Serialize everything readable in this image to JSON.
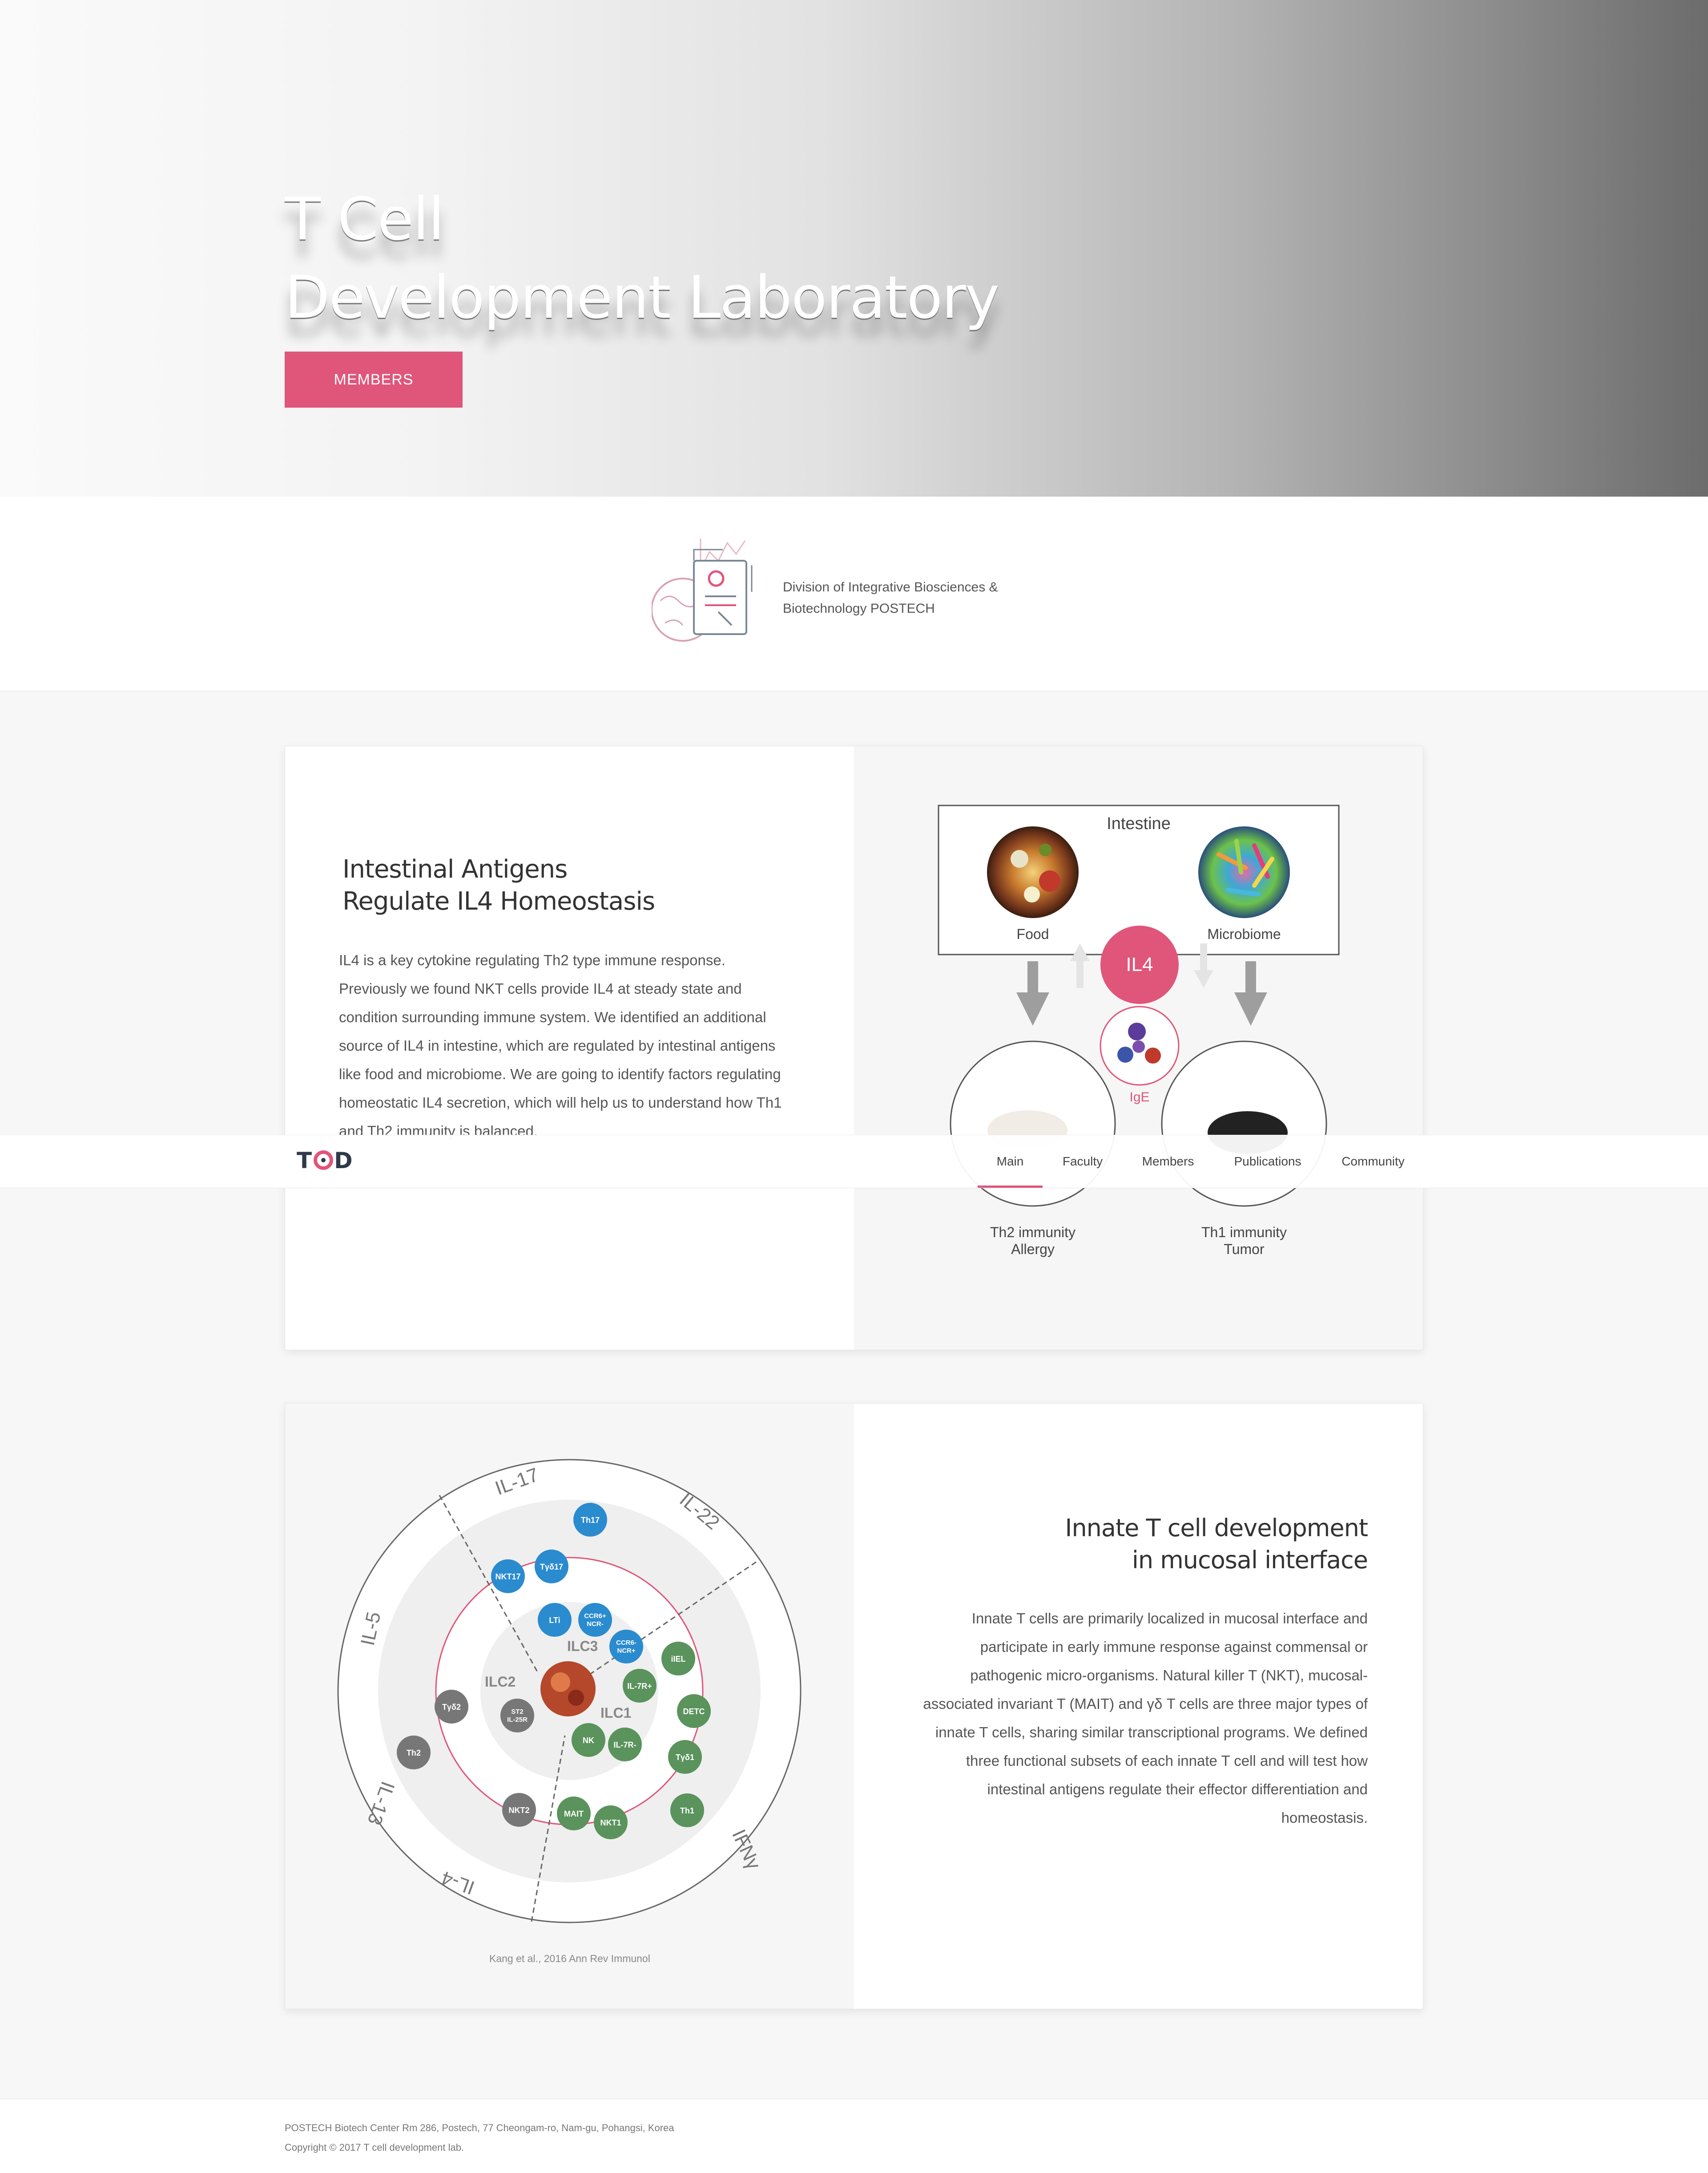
{
  "hero": {
    "title_line1": "T Cell",
    "title_line2": "Development Laboratory",
    "button_label": "MEMBERS"
  },
  "division": {
    "text_line1": "Division of Integrative Biosciences &",
    "text_line2": "Biotechnology POSTECH"
  },
  "section1": {
    "title_line1": "Intestinal Antigens",
    "title_line2": "Regulate IL4 Homeostasis",
    "body": "IL4 is a key cytokine regulating Th2 type immune response.\nPreviously we found NKT cells provide IL4 at steady state and\ncondition surrounding immune system. We identified an additional\nsource of IL4 in intestine, which are regulated by intestinal antigens\nlike food and microbiome. We are going to identify factors regulating\nhomeostatic IL4 secretion, which will help us to understand how Th1\nand Th2 immunity is balanced.",
    "figure": {
      "box_title": "Intestine",
      "food_label": "Food",
      "microbiome_label": "Microbiome",
      "il4_label": "IL4",
      "ige_label": "IgE",
      "left_outcome_line1": "Th2 immunity",
      "left_outcome_line2": "Allergy",
      "right_outcome_line1": "Th1 immunity",
      "right_outcome_line2": "Tumor"
    }
  },
  "section2": {
    "title_line1": "Innate T cell development",
    "title_line2": "in mucosal interface",
    "body": "Innate T cells are primarily localized in mucosal interface and\nparticipate in early immune response against commensal or\npathogenic micro-organisms. Natural killer T (NKT), mucosal-\nassociated invariant T (MAIT) and γδ T cells are three major types of\ninnate T cells, sharing similar transcriptional programs. We defined\nthree functional subsets of each innate T cell and will test how\nintestinal antigens regulate their effector differentiation and\nhomeostasis.",
    "citation": "Kang et al., 2016 Ann Rev Immunol",
    "wheel": {
      "cytokines": [
        "IL-17",
        "IL-22",
        "IFNγ",
        "IL-4",
        "IL-13",
        "IL-5"
      ],
      "groups": [
        "ILC2",
        "ILC3",
        "ILC1"
      ],
      "cells_blue": [
        "Th17",
        "Tγδ17",
        "NKT17",
        "LTi",
        "CCR6+ NCR-",
        "CCR6- NCR+"
      ],
      "cells_green": [
        "iIEL",
        "IL-7R+",
        "DETC",
        "NK",
        "IL-7R-",
        "Tγδ1",
        "Th1",
        "MAIT",
        "NKT1"
      ],
      "cells_grey": [
        "Tγδ2",
        "ST2 IL-25R",
        "Th2",
        "NKT2"
      ]
    }
  },
  "nav": {
    "logo_t": "T",
    "logo_d": "D",
    "items": [
      "Main",
      "Faculty",
      "Members",
      "Publications",
      "Community"
    ]
  },
  "footer": {
    "address": "POSTECH Biotech Center Rm 286, Postech, 77 Cheongam-ro, Nam-gu, Pohangsi, Korea",
    "copyright": "Copyright © 2017 T cell development lab."
  },
  "colors": {
    "accent": "#e0557a",
    "blue": "#2a8bcf",
    "green": "#5a935c",
    "grey": "#777777",
    "dark": "#2f3a48"
  }
}
